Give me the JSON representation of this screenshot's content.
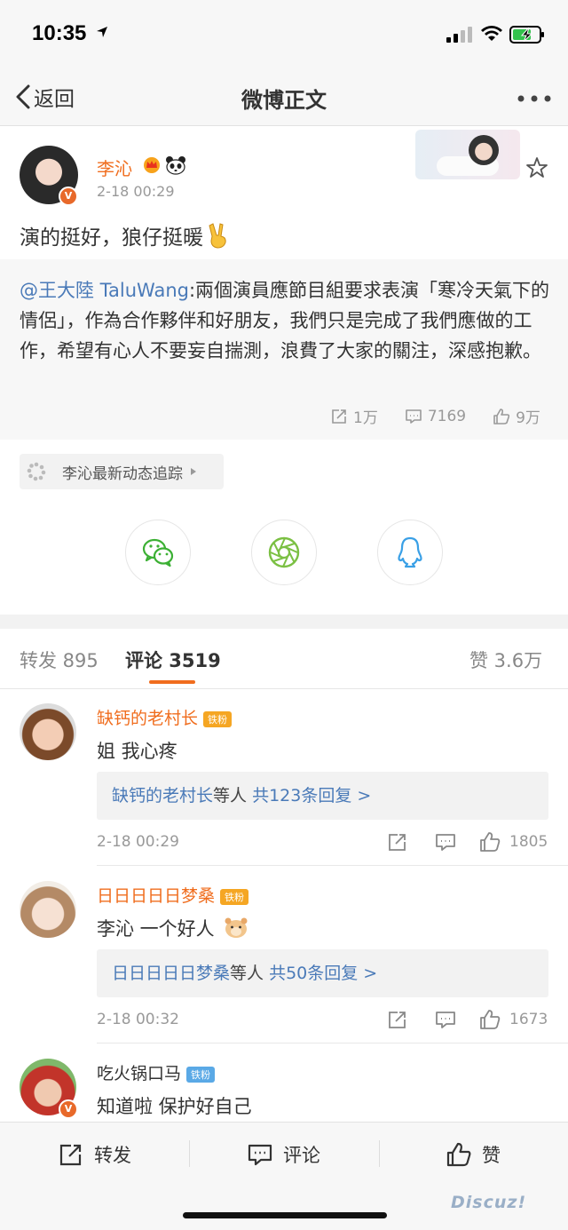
{
  "status_bar": {
    "time": "10:35"
  },
  "nav": {
    "back_label": "返回",
    "title": "微博正文"
  },
  "post": {
    "username": "李沁",
    "time": "2-18 00:29",
    "text": "演的挺好，狼仔挺暖"
  },
  "retweet": {
    "mention": "@王大陸 TaluWang",
    "text": ":兩個演員應節目組要求表演「寒冷天氣下的情侶」，作為合作夥伴和好朋友，我們只是完成了我們應做的工作，希望有心人不要妄自揣測，浪費了大家的關注，深感抱歉。",
    "stats": {
      "reposts": "1万",
      "comments": "7169",
      "likes": "9万"
    }
  },
  "topic_chip": {
    "label": "李沁最新动态追踪"
  },
  "tabs": {
    "repost": "转发 895",
    "comment": "评论 3519",
    "like": "赞 3.6万"
  },
  "comments": [
    {
      "name": "缺钙的老村长",
      "badge": "铁粉",
      "text": "姐 我心疼",
      "reply_who": "缺钙的老村长",
      "reply_mid": "等人",
      "reply_link": "共123条回复 >",
      "time": "2-18 00:29",
      "likes": "1805"
    },
    {
      "name": "日日日日日梦桑",
      "badge": "铁粉",
      "text": "李沁 一个好人",
      "reply_who": "日日日日日梦桑",
      "reply_mid": "等人",
      "reply_link": "共50条回复 >",
      "time": "2-18 00:32",
      "likes": "1673"
    },
    {
      "name": "吃火锅口马",
      "badge": "铁粉",
      "text": "知道啦 保护好自己"
    }
  ],
  "bottom_bar": {
    "repost": "转发",
    "comment": "评论",
    "like": "赞"
  },
  "watermark": "Discuz!",
  "colors": {
    "accent": "#f06d1e",
    "link": "#4a7ab8",
    "wechat": "#3cb034",
    "moments": "#7bc043",
    "qq": "#3aa0e6"
  }
}
